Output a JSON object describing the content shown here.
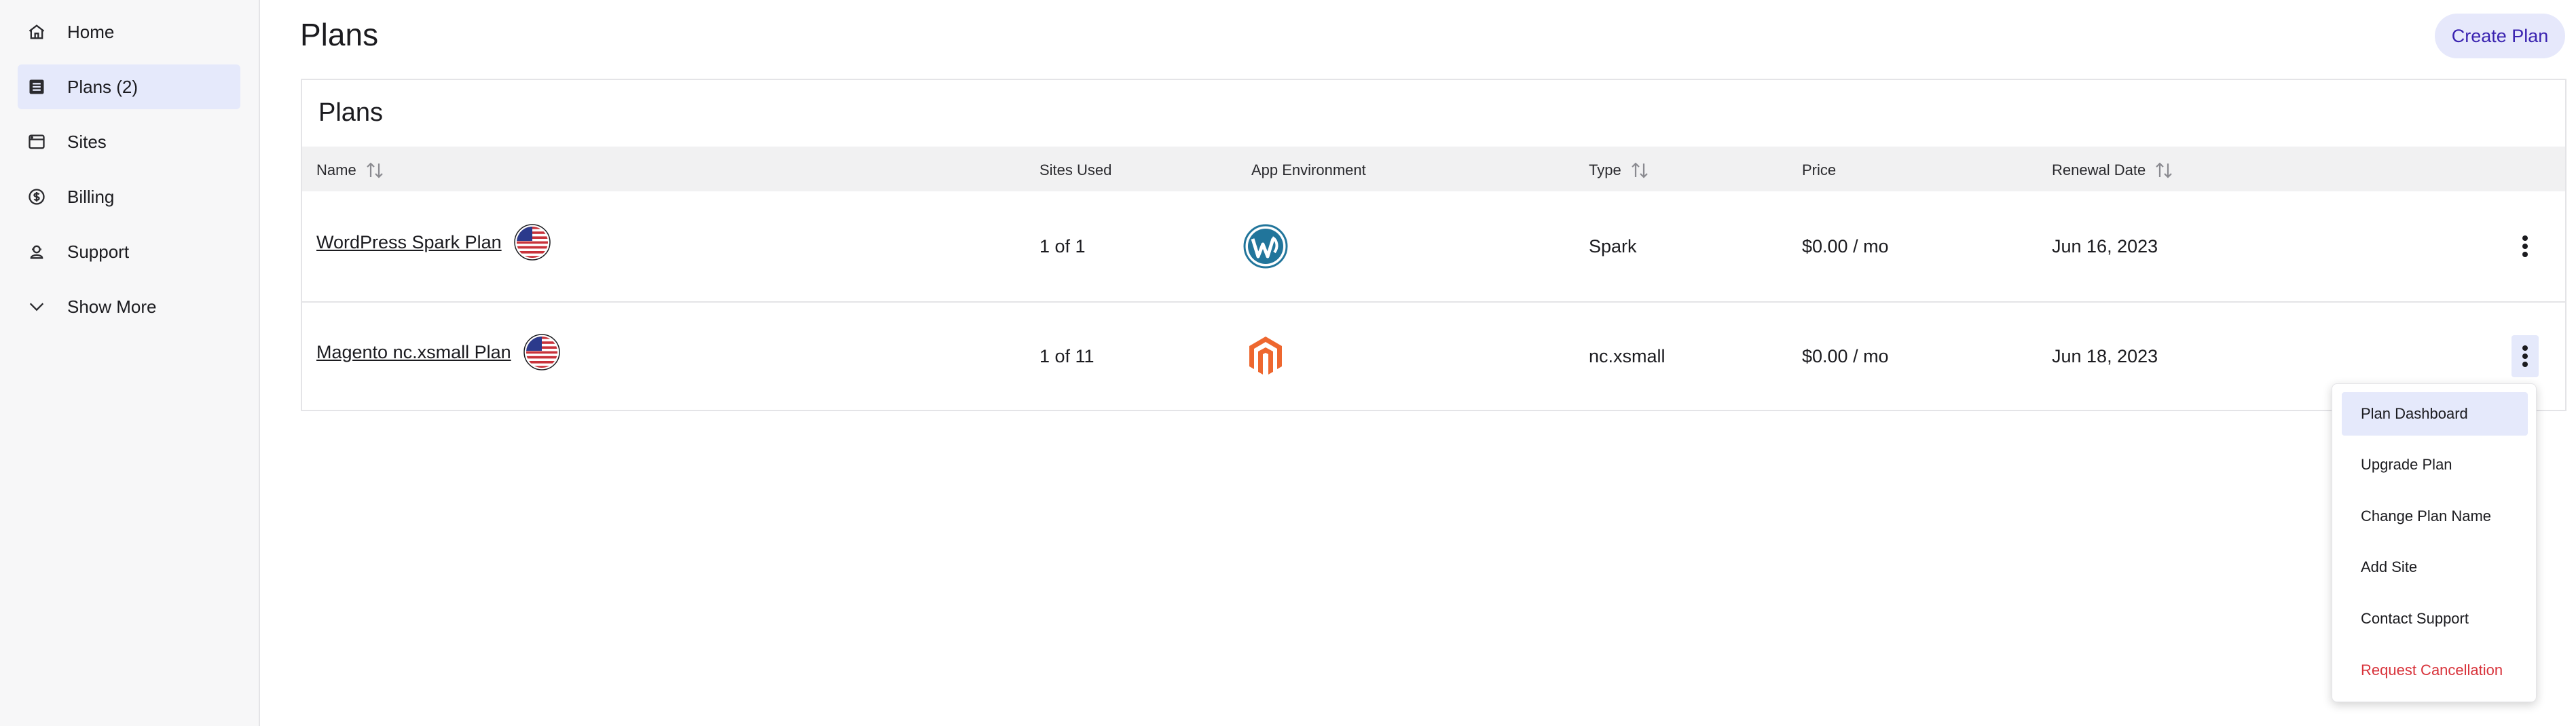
{
  "sidebar": {
    "items": [
      {
        "label": "Home",
        "icon": "home-icon",
        "active": false
      },
      {
        "label": "Plans (2)",
        "icon": "plans-icon",
        "active": true
      },
      {
        "label": "Sites",
        "icon": "sites-icon",
        "active": false
      },
      {
        "label": "Billing",
        "icon": "billing-icon",
        "active": false
      },
      {
        "label": "Support",
        "icon": "support-icon",
        "active": false
      },
      {
        "label": "Show More",
        "icon": "chevron-down-icon",
        "active": false
      }
    ]
  },
  "header": {
    "title": "Plans",
    "create_label": "Create Plan"
  },
  "card": {
    "title": "Plans",
    "columns": [
      "Name",
      "Sites Used",
      "App Environment",
      "Type",
      "Price",
      "Renewal Date"
    ],
    "rows": [
      {
        "name": "WordPress Spark Plan",
        "sites_used": "1 of 1",
        "app": "wordpress-logo-icon",
        "type": "Spark",
        "price": "$0.00 / mo",
        "renewal": "Jun 16, 2023"
      },
      {
        "name": "Magento nc.xsmall Plan",
        "sites_used": "1 of 11",
        "app": "magento-logo-icon",
        "type": "nc.xsmall",
        "price": "$0.00 / mo",
        "renewal": "Jun 18, 2023"
      }
    ]
  },
  "menu": {
    "items": [
      "Plan Dashboard",
      "Upgrade Plan",
      "Change Plan Name",
      "Add Site",
      "Contact Support",
      "Request Cancellation"
    ]
  },
  "colors": {
    "accent": "#3a23b0",
    "active_bg": "#e5e9fb",
    "danger": "#d8323a",
    "wordpress": "#21759b",
    "magento": "#ee672f"
  }
}
